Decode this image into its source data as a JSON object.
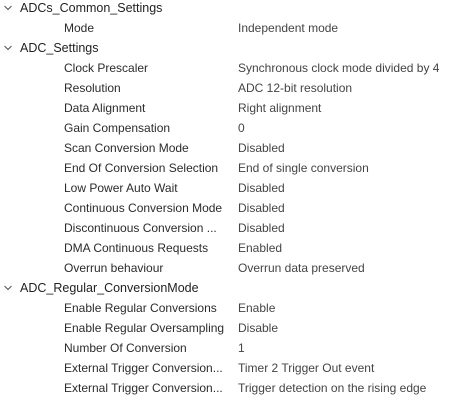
{
  "groups": [
    {
      "label": "ADCs_Common_Settings",
      "expanded": true,
      "props": [
        {
          "name": "Mode",
          "value": "Independent mode"
        }
      ]
    },
    {
      "label": "ADC_Settings",
      "expanded": true,
      "props": [
        {
          "name": "Clock Prescaler",
          "value": "Synchronous clock mode divided by 4"
        },
        {
          "name": "Resolution",
          "value": "ADC 12-bit resolution"
        },
        {
          "name": "Data Alignment",
          "value": "Right alignment"
        },
        {
          "name": "Gain Compensation",
          "value": "0"
        },
        {
          "name": "Scan Conversion Mode",
          "value": "Disabled"
        },
        {
          "name": "End Of Conversion Selection",
          "value": "End of single conversion"
        },
        {
          "name": "Low Power Auto Wait",
          "value": "Disabled"
        },
        {
          "name": "Continuous Conversion Mode",
          "value": "Disabled"
        },
        {
          "name": "Discontinuous Conversion ...",
          "value": "Disabled"
        },
        {
          "name": "DMA Continuous Requests",
          "value": "Enabled"
        },
        {
          "name": "Overrun behaviour",
          "value": "Overrun data preserved"
        }
      ]
    },
    {
      "label": "ADC_Regular_ConversionMode",
      "expanded": true,
      "props": [
        {
          "name": "Enable Regular Conversions",
          "value": "Enable"
        },
        {
          "name": "Enable Regular Oversampling",
          "value": "Disable"
        },
        {
          "name": "Number Of Conversion",
          "value": "1"
        },
        {
          "name": "External Trigger Conversion...",
          "value": "Timer 2 Trigger Out event"
        },
        {
          "name": "External Trigger Conversion...",
          "value": "Trigger detection on the rising edge"
        }
      ]
    }
  ],
  "icons": {
    "expand": "chevron-down-icon"
  },
  "colors": {
    "text": "#2b2b2b",
    "value_text": "#444444",
    "chevron": "#555555",
    "background": "#ffffff"
  }
}
